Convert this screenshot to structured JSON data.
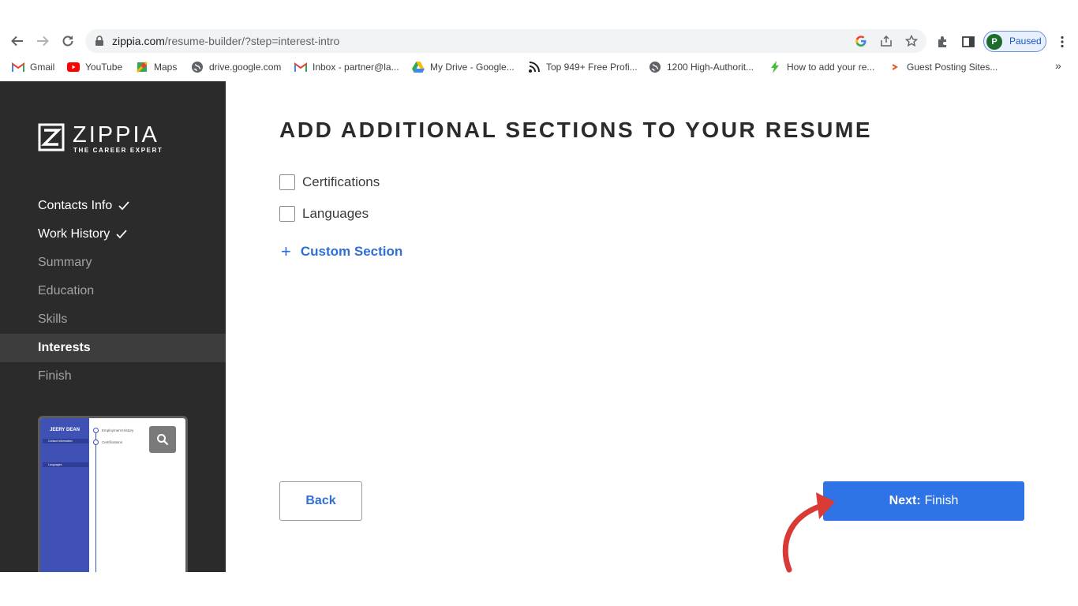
{
  "browser": {
    "url_host": "zippia.com",
    "url_path": "/resume-builder/?step=interest-intro",
    "profile_initial": "P",
    "profile_status": "Paused",
    "bookmarks": [
      {
        "label": "Gmail",
        "icon": "gmail-icon"
      },
      {
        "label": "YouTube",
        "icon": "youtube-icon"
      },
      {
        "label": "Maps",
        "icon": "maps-icon"
      },
      {
        "label": "drive.google.com",
        "icon": "globe-icon"
      },
      {
        "label": "Inbox - partner@la...",
        "icon": "gmail-icon"
      },
      {
        "label": "My Drive - Google...",
        "icon": "drive-icon"
      },
      {
        "label": "Top 949+ Free Profi...",
        "icon": "feed-icon"
      },
      {
        "label": "1200 High-Authorit...",
        "icon": "globe-icon"
      },
      {
        "label": "How to add your re...",
        "icon": "bolt-icon"
      },
      {
        "label": "Guest Posting Sites...",
        "icon": "site-icon"
      }
    ],
    "more_bookmarks": "»"
  },
  "sidebar": {
    "logo_word": "ZIPPIA",
    "logo_tagline": "THE CAREER EXPERT",
    "steps": [
      {
        "label": "Contacts Info",
        "state": "done"
      },
      {
        "label": "Work History",
        "state": "done"
      },
      {
        "label": "Summary",
        "state": "todo"
      },
      {
        "label": "Education",
        "state": "todo"
      },
      {
        "label": "Skills",
        "state": "todo"
      },
      {
        "label": "Interests",
        "state": "active"
      },
      {
        "label": "Finish",
        "state": "todo"
      }
    ],
    "preview": {
      "name": "JEERY DEAN",
      "contact_heading": "Contact Information",
      "languages_heading": "Languages",
      "employment_heading": "Employment History",
      "certifications_heading": "Certifications"
    }
  },
  "main": {
    "heading": "ADD ADDITIONAL SECTIONS TO YOUR RESUME",
    "options": [
      {
        "label": "Certifications",
        "checked": false
      },
      {
        "label": "Languages",
        "checked": false
      }
    ],
    "custom_plus": "+",
    "custom_label": "Custom Section",
    "back_label": "Back",
    "next_prefix": "Next:",
    "next_label": "Finish"
  },
  "colors": {
    "sidebar_bg": "#2b2b2b",
    "accent_blue": "#2f74e6",
    "link_blue": "#2f6fd6",
    "annotation_red": "#d93a36"
  }
}
